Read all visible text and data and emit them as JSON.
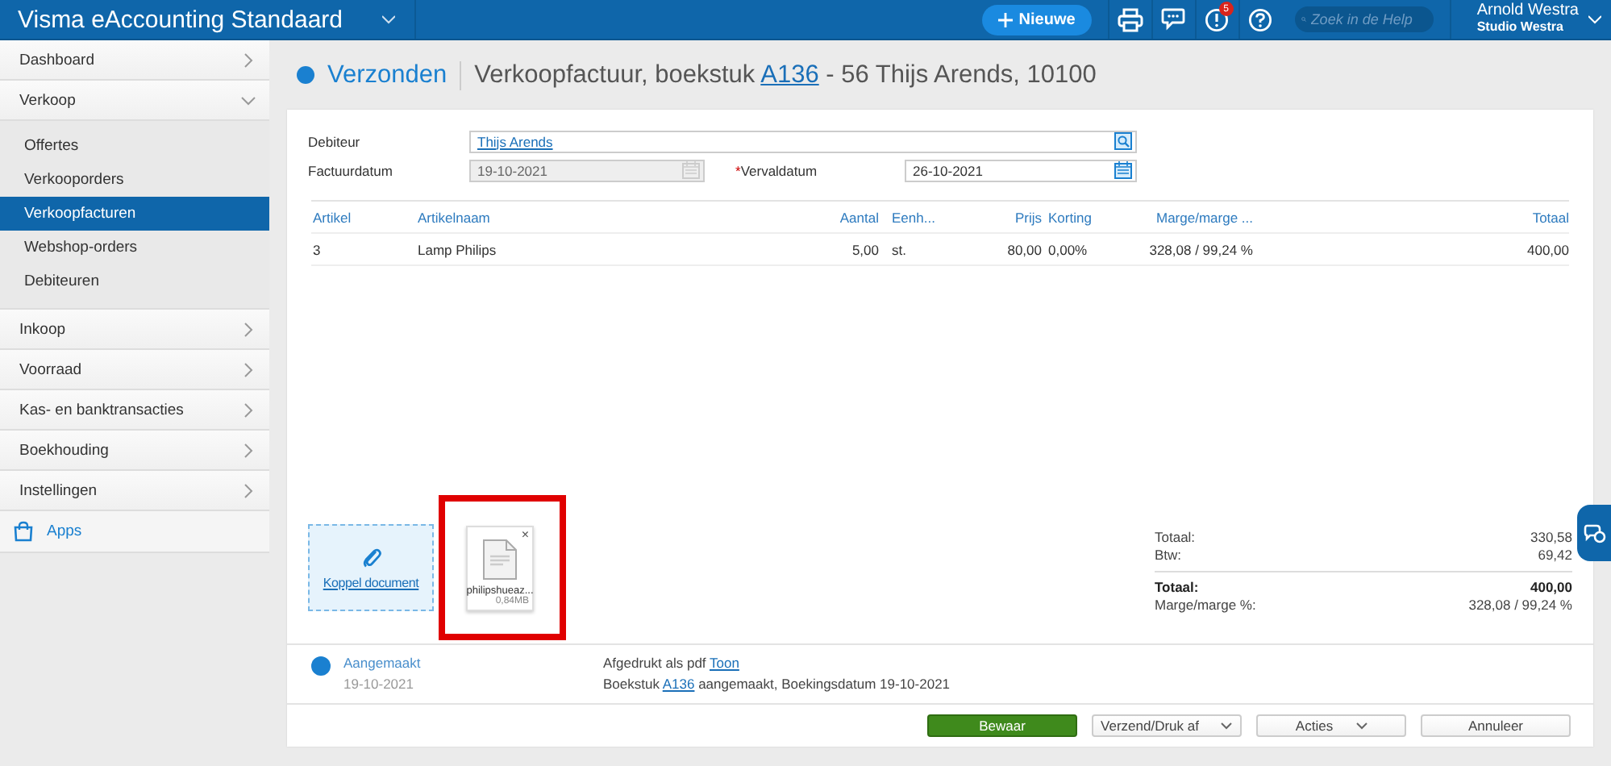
{
  "app": {
    "title": "Visma eAccounting Standaard"
  },
  "topbar": {
    "new_button": "Nieuwe",
    "notification_count": "5",
    "search": {
      "placeholder": "Zoek in de Help"
    },
    "user": {
      "name": "Arnold Westra",
      "company": "Studio Westra"
    }
  },
  "sidebar": {
    "items": [
      {
        "label": "Dashboard",
        "expanded": false
      },
      {
        "label": "Verkoop",
        "expanded": true,
        "children": [
          {
            "label": "Offertes",
            "selected": false
          },
          {
            "label": "Verkooporders",
            "selected": false
          },
          {
            "label": "Verkoopfacturen",
            "selected": true
          },
          {
            "label": "Webshop-orders",
            "selected": false
          },
          {
            "label": "Debiteuren",
            "selected": false
          }
        ]
      },
      {
        "label": "Inkoop",
        "expanded": false
      },
      {
        "label": "Voorraad",
        "expanded": false
      },
      {
        "label": "Kas- en banktransacties",
        "expanded": false
      },
      {
        "label": "Boekhouding",
        "expanded": false
      },
      {
        "label": "Instellingen",
        "expanded": false
      }
    ],
    "apps": "Apps"
  },
  "header": {
    "status": "Verzonden",
    "title_prefix": "Verkoopfactuur, boekstuk",
    "title_link": "A136",
    "title_suffix": "- 56 Thijs Arends, 10100"
  },
  "form": {
    "debtor": {
      "label": "Debiteur",
      "value": "Thijs Arends"
    },
    "invoice_date": {
      "label": "Factuurdatum",
      "value": "19-10-2021",
      "disabled": true
    },
    "due_date": {
      "label": "Vervaldatum",
      "required_mark": "*",
      "value": "26-10-2021",
      "disabled": false
    }
  },
  "table": {
    "columns": [
      "Artikel",
      "Artikelnaam",
      "Aantal",
      "Eenh...",
      "Prijs",
      "Korting",
      "Marge/marge ...",
      "Totaal"
    ],
    "rows": [
      [
        "3",
        "Lamp Philips",
        "5,00",
        "st.",
        "80,00",
        "0,00%",
        "328,08 / 99,24 %",
        "400,00"
      ]
    ]
  },
  "attachments": {
    "button": "Koppel document",
    "files": [
      {
        "name": "philipshueaz...",
        "size": "0,84MB",
        "remove": "×"
      }
    ]
  },
  "totals": [
    {
      "label": "Totaal:",
      "value": "330,58",
      "bold": false
    },
    {
      "label": "Btw:",
      "value": "69,42",
      "bold": false
    },
    {
      "label": "Totaal:",
      "value": "400,00",
      "bold": true
    },
    {
      "label": "Marge/marge %:",
      "value": "328,08 / 99,24 %",
      "bold": false
    }
  ],
  "history": [
    {
      "status": "Aangemaakt",
      "date": "19-10-2021",
      "lines": [
        {
          "text": "Afgedrukt als pdf",
          "link": "Toon"
        },
        {
          "text": "Boekstuk",
          "link": "A136",
          "after": "aangemaakt, Boekingsdatum 19-10-2021"
        }
      ]
    }
  ],
  "buttons": [
    {
      "label": "Bewaar",
      "kind": "primary"
    },
    {
      "label": "Verzend/Druk af",
      "kind": "dropdown"
    },
    {
      "label": "Acties",
      "kind": "dropdown"
    },
    {
      "label": "Annuleer",
      "kind": "plain"
    }
  ]
}
